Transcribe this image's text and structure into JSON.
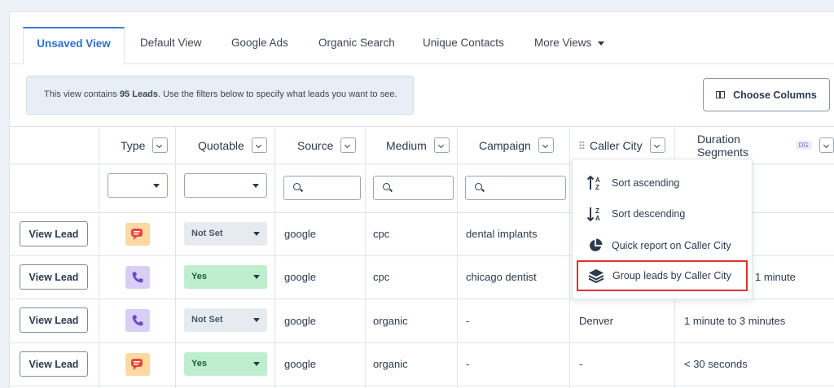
{
  "tabs": [
    {
      "label": "Unsaved View",
      "active": true
    },
    {
      "label": "Default View"
    },
    {
      "label": "Google Ads"
    },
    {
      "label": "Organic Search"
    },
    {
      "label": "Unique Contacts"
    },
    {
      "label": "More Views"
    }
  ],
  "banner": {
    "prefix": "This view contains ",
    "count": "95 Leads",
    "suffix": ". Use the filters below to specify what leads you want to see."
  },
  "choose_columns_label": "Choose Columns",
  "columns": {
    "type": "Type",
    "quotable": "Quotable",
    "source": "Source",
    "medium": "Medium",
    "campaign": "Campaign",
    "caller_city": "Caller City",
    "duration": "Duration Segments",
    "duration_badge": "DG"
  },
  "rows": [
    {
      "action": "View Lead",
      "type_icon": "chat-icon",
      "quotable": "Not Set",
      "source": "google",
      "medium": "cpc",
      "campaign": "dental implants",
      "city": "",
      "duration": ""
    },
    {
      "action": "View Lead",
      "type_icon": "phone-icon",
      "quotable": "Yes",
      "source": "google",
      "medium": "cpc",
      "campaign": "chicago dentist",
      "city": "",
      "duration": "1 minute"
    },
    {
      "action": "View Lead",
      "type_icon": "phone-icon",
      "quotable": "Not Set",
      "source": "google",
      "medium": "organic",
      "campaign": "-",
      "city": "Denver",
      "duration": "1 minute to 3 minutes"
    },
    {
      "action": "View Lead",
      "type_icon": "chat-icon",
      "quotable": "Yes",
      "source": "google",
      "medium": "organic",
      "campaign": "-",
      "city": "-",
      "duration": "< 30 seconds"
    }
  ],
  "menu": {
    "items": [
      {
        "label": "Sort ascending",
        "icon": "sort-ascending-icon"
      },
      {
        "label": "Sort descending",
        "icon": "sort-descending-icon"
      },
      {
        "label": "Quick report on Caller City",
        "icon": "pie-chart-icon"
      },
      {
        "label": "Group leads by Caller City",
        "icon": "layers-icon",
        "highlighted": true
      }
    ]
  },
  "colors": {
    "accent": "#2f6fcf",
    "yes_bg": "#bfeecf",
    "notset_bg": "#e6ebf0",
    "highlight_border": "#e03131",
    "chat_icon_bg": "#fcd8a3",
    "phone_icon_bg": "#d9cff6"
  }
}
